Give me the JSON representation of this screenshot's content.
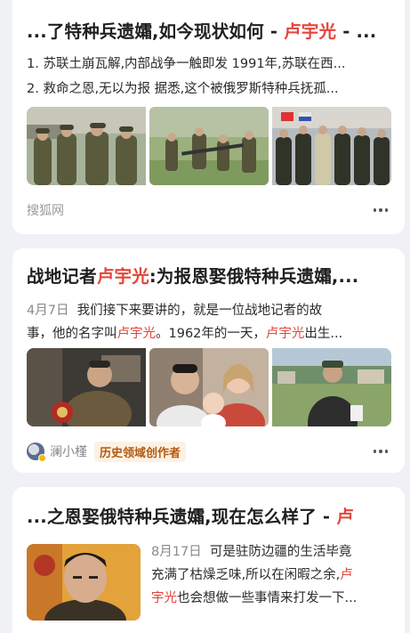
{
  "results": [
    {
      "title_prefix": "...了特种兵遗孀,如今现状如何 - ",
      "title_highlight": "卢宇光",
      "title_suffix": " - ...",
      "lines": [
        "1. 苏联土崩瓦解,内部战争一触即发 1991年,苏联在西...",
        "2. 救命之恩,无以为报 据悉,这个被俄罗斯特种兵抚孤..."
      ],
      "images": [
        "soldiers-group-photo",
        "soldiers-field-photo",
        "soldiers-formation-photo"
      ],
      "source": "搜狐网"
    },
    {
      "title_prefix": "战地记者",
      "title_highlight": "卢宇光",
      "title_suffix": ":为报恩娶俄特种兵遗孀,...",
      "date": "4月7日",
      "line1": "我们接下来要讲的，就是一位战地记者的故",
      "line2_a": "事，他的名字叫",
      "line2_hl": "卢宇光",
      "line2_b": "。1962年的一天，",
      "line2_hl2": "卢宇光",
      "line2_c": "出生...",
      "images": [
        "man-in-office-photo",
        "family-photo",
        "man-outdoors-photo"
      ],
      "author": "澜小槿",
      "author_tag": "历史领域创作者"
    },
    {
      "title_prefix": "...之恩娶俄特种兵遗孀,现在怎么样了 - ",
      "title_highlight": "卢",
      "date": "8月17日",
      "line1": "可是驻防边疆的生活毕竟",
      "line2": "充满了枯燥乏味,所以在闲暇之余,",
      "line2_hl": "卢",
      "line3_hl": "宇光",
      "line3": "也会想做一些事情来打发一下...",
      "image": "man-portrait-photo"
    }
  ],
  "colors": {
    "highlight": "#e3453a",
    "page_bg": "#f0f1f5",
    "tag_text": "#b15b12",
    "tag_bg": "#fdf1e4"
  },
  "more_icon": "ellipsis-icon"
}
